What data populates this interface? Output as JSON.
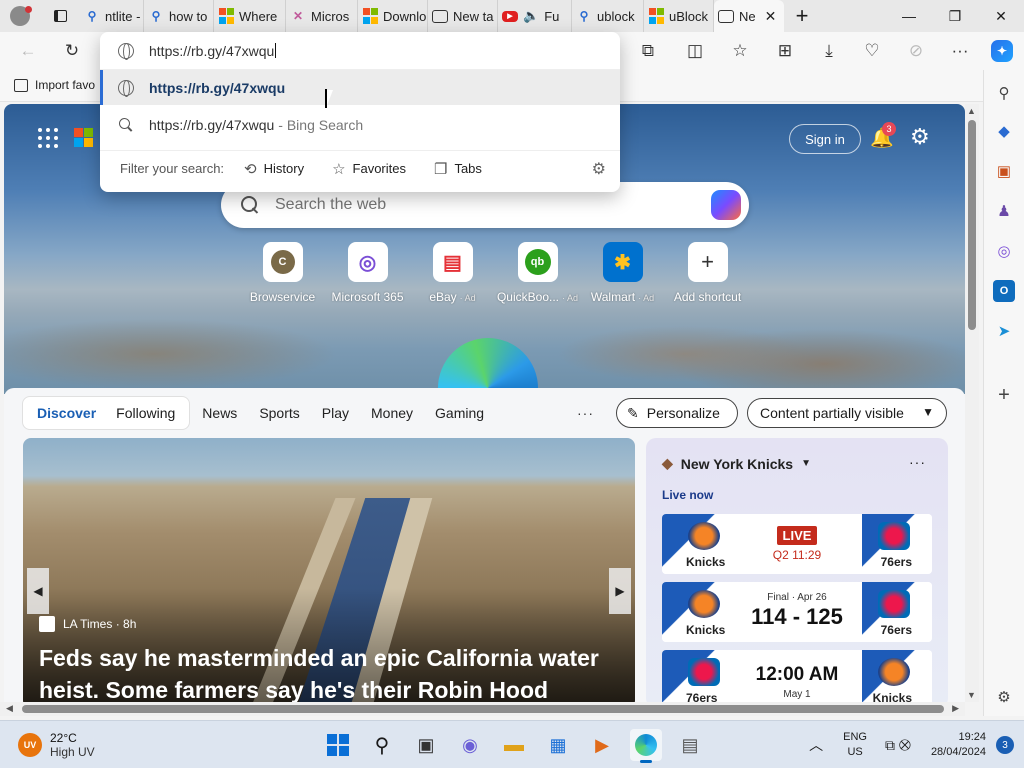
{
  "tabs": [
    {
      "label": "ntlite -",
      "fav": "search"
    },
    {
      "label": "how to",
      "fav": "search"
    },
    {
      "label": "Where",
      "fav": "ms"
    },
    {
      "label": "Micros",
      "fav": "x"
    },
    {
      "label": "Downlo",
      "fav": "ms"
    },
    {
      "label": "New ta",
      "fav": "newtab"
    },
    {
      "label": "Fu",
      "fav": "yt"
    },
    {
      "label": "ublock",
      "fav": "search"
    },
    {
      "label": "uBlock",
      "fav": "ms"
    },
    {
      "label": "Ne",
      "fav": "newtab",
      "active": true
    }
  ],
  "favorites_bar": {
    "import_label": "Import favo"
  },
  "omnibox": {
    "typed": "https://rb.gy/47xwqu",
    "suggestion_url": "https://rb.gy/47xwqu",
    "suggestion_search": "https://rb.gy/47xwqu",
    "suggestion_search_hint": "- Bing Search",
    "filter_label": "Filter your search:",
    "filters": [
      "History",
      "Favorites",
      "Tabs"
    ]
  },
  "ntp": {
    "signin": "Sign in",
    "notification_count": "3",
    "search_placeholder": "Search the web",
    "tiles": [
      {
        "label": "Browservice",
        "icon": "C",
        "ad": ""
      },
      {
        "label": "Microsoft 365",
        "icon": "◎",
        "ad": ""
      },
      {
        "label": "eBay",
        "icon": "▤",
        "ad": "· Ad"
      },
      {
        "label": "QuickBoo...",
        "icon": "qb",
        "ad": "· Ad"
      },
      {
        "label": "Walmart",
        "icon": "✱",
        "ad": "· Ad"
      },
      {
        "label": "Add shortcut",
        "icon": "+",
        "ad": ""
      }
    ],
    "feed_tabs": {
      "discover": "Discover",
      "following": "Following"
    },
    "feed_links": [
      "News",
      "Sports",
      "Play",
      "Money",
      "Gaming"
    ],
    "more": "···",
    "personalize": "Personalize",
    "content_visibility": "Content partially visible",
    "article": {
      "source": "LA Times · 8h",
      "headline": "Feds say he masterminded an epic California water heist. Some farmers say he's their Robin Hood"
    },
    "sports": {
      "team": "New York Knicks",
      "live_label": "Live now",
      "games": [
        {
          "left": "Knicks",
          "right": "76ers",
          "status": "LIVE",
          "detail": "Q2 11:29",
          "type": "live"
        },
        {
          "left": "Knicks",
          "right": "76ers",
          "status": "Final · Apr 26",
          "detail": "114 - 125",
          "type": "final"
        },
        {
          "left": "76ers",
          "right": "Knicks",
          "status": "12:00 AM",
          "detail": "May 1",
          "type": "upcoming"
        }
      ]
    }
  },
  "taskbar": {
    "temp": "22°C",
    "uv_text": "High UV",
    "uv_badge": "UV",
    "lang1": "ENG",
    "lang2": "US",
    "time": "19:24",
    "date": "28/04/2024",
    "notif": "3"
  },
  "colors": {
    "accent": "#1a5fb4",
    "live": "#c42b1c",
    "sixers_blue": "#1d5bb8"
  }
}
